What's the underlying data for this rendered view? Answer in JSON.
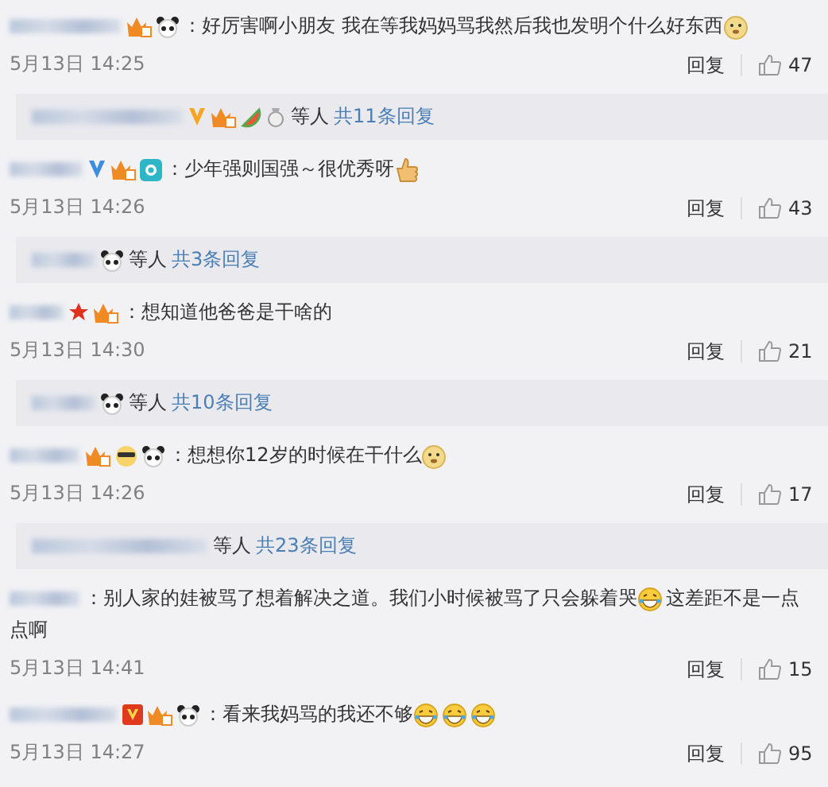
{
  "comments": [
    {
      "badges": [
        {
          "kind": "crown"
        },
        {
          "kind": "panda"
        }
      ],
      "content": [
        {
          "kind": "text",
          "text": "：好厉害啊小朋友 我在等我妈妈骂我然后我也发明个什么好东西"
        },
        {
          "kind": "doge"
        }
      ],
      "time": "5月13日 14:25",
      "reply_label": "回复",
      "likes": "47",
      "replies": {
        "badges": [
          {
            "kind": "vorange"
          },
          {
            "kind": "crown"
          },
          {
            "kind": "melon"
          },
          {
            "kind": "medal"
          }
        ],
        "suffix": "等人",
        "link": "共11条回复"
      }
    },
    {
      "badges": [
        {
          "kind": "vblue"
        },
        {
          "kind": "crown"
        },
        {
          "kind": "camera"
        }
      ],
      "content": [
        {
          "kind": "text",
          "text": "：少年强则国强～很优秀呀"
        },
        {
          "kind": "thumb"
        }
      ],
      "time": "5月13日 14:26",
      "reply_label": "回复",
      "likes": "43",
      "replies": {
        "badges": [
          {
            "kind": "panda"
          }
        ],
        "suffix": "等人",
        "link": "共3条回复"
      }
    },
    {
      "badges": [
        {
          "kind": "star"
        },
        {
          "kind": "crown"
        }
      ],
      "content": [
        {
          "kind": "text",
          "text": "：想知道他爸爸是干啥的"
        }
      ],
      "time": "5月13日 14:30",
      "reply_label": "回复",
      "likes": "21",
      "replies": {
        "badges": [
          {
            "kind": "panda"
          }
        ],
        "suffix": "等人",
        "link": "共10条回复"
      }
    },
    {
      "badges": [
        {
          "kind": "crown"
        },
        {
          "kind": "cool"
        },
        {
          "kind": "panda"
        }
      ],
      "content": [
        {
          "kind": "text",
          "text": "：想想你12岁的时候在干什么"
        },
        {
          "kind": "doge"
        }
      ],
      "time": "5月13日 14:26",
      "reply_label": "回复",
      "likes": "17",
      "replies": {
        "suffix": "等人",
        "link": "共23条回复"
      }
    },
    {
      "content": [
        {
          "kind": "text",
          "text": "：别人家的娃被骂了想着解决之道。我们小时候被骂了只会躲着哭"
        },
        {
          "kind": "laugh"
        },
        {
          "kind": "text",
          "text": "这差距不是一点点啊"
        }
      ],
      "time": "5月13日 14:41",
      "reply_label": "回复",
      "likes": "15"
    },
    {
      "badges": [
        {
          "kind": "vbox"
        },
        {
          "kind": "crown"
        },
        {
          "kind": "panda"
        }
      ],
      "content": [
        {
          "kind": "text",
          "text": "：看来我妈骂的我还不够"
        },
        {
          "kind": "laugh"
        },
        {
          "kind": "laugh"
        },
        {
          "kind": "laugh"
        }
      ],
      "time": "5月13日 14:27",
      "reply_label": "回复",
      "likes": "95"
    }
  ]
}
